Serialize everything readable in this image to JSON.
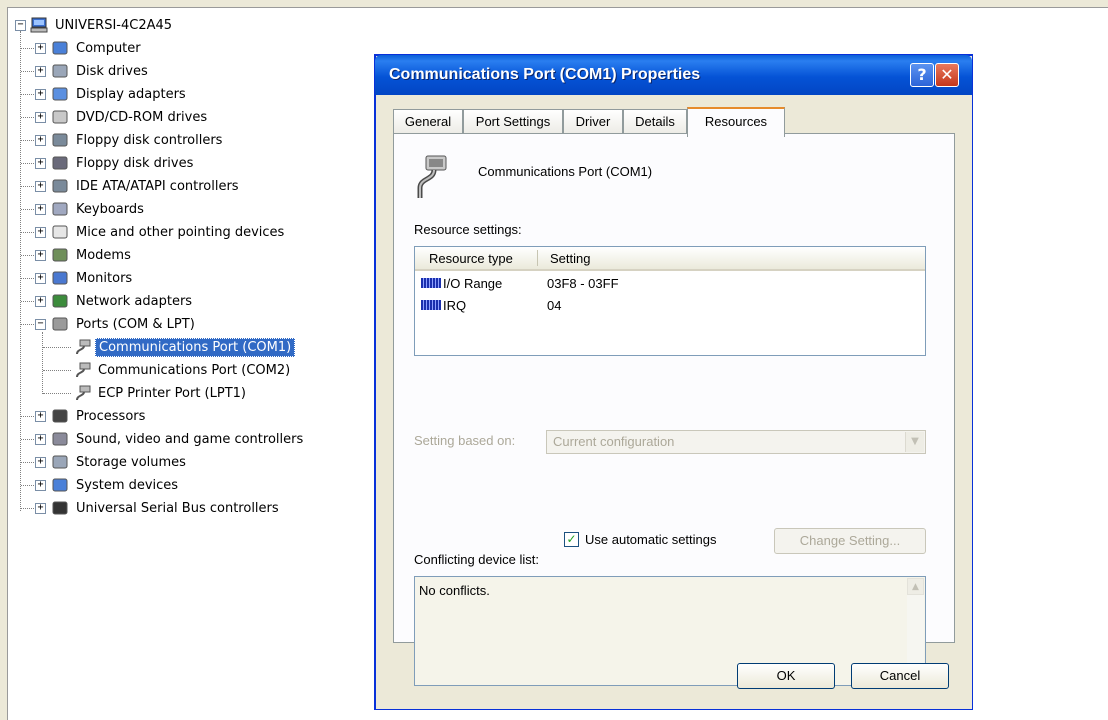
{
  "tree": {
    "root": "UNIVERSI-4C2A45",
    "categories": [
      {
        "label": "Computer",
        "icon": "computer-icon"
      },
      {
        "label": "Disk drives",
        "icon": "disk-drive-icon"
      },
      {
        "label": "Display adapters",
        "icon": "display-adapter-icon"
      },
      {
        "label": "DVD/CD-ROM drives",
        "icon": "dvd-drive-icon"
      },
      {
        "label": "Floppy disk controllers",
        "icon": "controller-icon"
      },
      {
        "label": "Floppy disk drives",
        "icon": "floppy-drive-icon"
      },
      {
        "label": "IDE ATA/ATAPI controllers",
        "icon": "controller-icon"
      },
      {
        "label": "Keyboards",
        "icon": "keyboard-icon"
      },
      {
        "label": "Mice and other pointing devices",
        "icon": "mouse-icon"
      },
      {
        "label": "Modems",
        "icon": "modem-icon"
      },
      {
        "label": "Monitors",
        "icon": "monitor-icon"
      },
      {
        "label": "Network adapters",
        "icon": "network-adapter-icon"
      },
      {
        "label": "Ports (COM & LPT)",
        "icon": "port-icon"
      },
      {
        "label": "Processors",
        "icon": "processor-icon"
      },
      {
        "label": "Sound, video and game controllers",
        "icon": "sound-icon"
      },
      {
        "label": "Storage volumes",
        "icon": "storage-volume-icon"
      },
      {
        "label": "System devices",
        "icon": "system-device-icon"
      },
      {
        "label": "Universal Serial Bus controllers",
        "icon": "usb-icon"
      }
    ],
    "ports_children": [
      "Communications Port (COM1)",
      "Communications Port (COM2)",
      "ECP Printer Port (LPT1)"
    ]
  },
  "dialog": {
    "title": "Communications Port (COM1) Properties",
    "help_button": "?",
    "close_button": "✕",
    "tabs": [
      "General",
      "Port Settings",
      "Driver",
      "Details",
      "Resources"
    ],
    "active_tab": "Resources",
    "device_name": "Communications Port (COM1)",
    "resource_settings_label": "Resource settings:",
    "table": {
      "headers": [
        "Resource type",
        "Setting"
      ],
      "rows": [
        {
          "type": "I/O Range",
          "setting": "03F8 - 03FF"
        },
        {
          "type": "IRQ",
          "setting": "04"
        }
      ]
    },
    "setting_based_on_label": "Setting based on:",
    "setting_based_on_value": "Current configuration",
    "use_auto_label": "Use automatic settings",
    "use_auto_checked": true,
    "change_setting_label": "Change Setting...",
    "conflict_label": "Conflicting device list:",
    "conflict_text": "No conflicts.",
    "ok_label": "OK",
    "cancel_label": "Cancel"
  },
  "colors": {
    "title_bar": "#0553d6",
    "selection": "#316ac5",
    "dialog_bg": "#ece9d8",
    "active_tab_accent": "#e68b2c"
  }
}
